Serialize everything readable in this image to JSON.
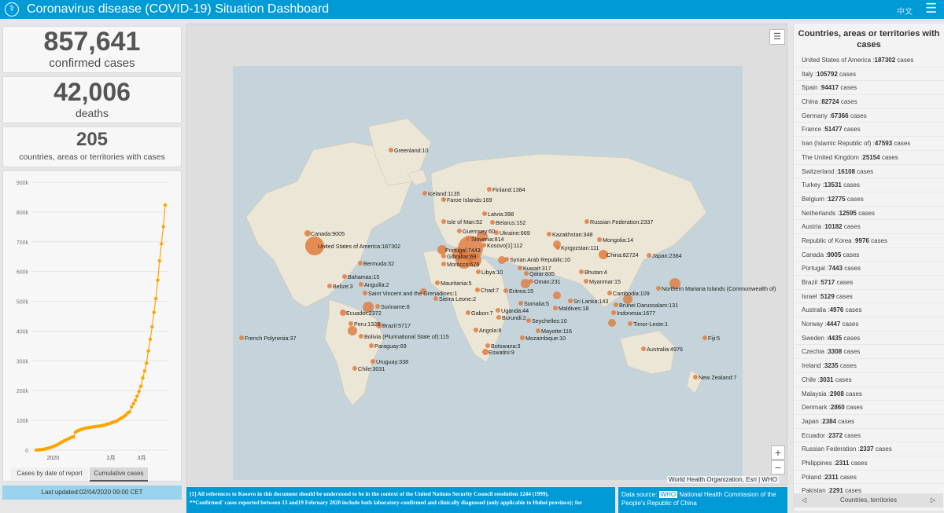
{
  "header": {
    "title": "Coronavirus disease (COVID-19) Situation Dashboard",
    "lang_label": "中文",
    "menu_icon": "hamburger-icon",
    "logo_icon": "who-logo-icon"
  },
  "stats": {
    "confirmed_value": "857,641",
    "confirmed_label": "confirmed cases",
    "deaths_value": "42,006",
    "deaths_label": "deaths",
    "countries_value": "205",
    "countries_label": "countries, areas or territories with cases"
  },
  "chart_data": {
    "type": "scatter",
    "title": "",
    "xlabel": "",
    "ylabel": "",
    "x_ticks": [
      "2020",
      "2月",
      "3月"
    ],
    "y_ticks": [
      "0",
      "100k",
      "200k",
      "300k",
      "400k",
      "500k",
      "600k",
      "700k",
      "800k",
      "900k"
    ],
    "ylim": [
      0,
      900000
    ],
    "series": [
      {
        "name": "",
        "color": "#ffa500",
        "values": [
          580,
          845,
          1317,
          2015,
          2800,
          4581,
          6057,
          7813,
          9821,
          11948,
          14551,
          17389,
          20630,
          24554,
          28276,
          31481,
          34886,
          37558,
          40554,
          43103,
          45171,
          60381,
          64543,
          67100,
          69197,
          71329,
          73332,
          75184,
          75700,
          76769,
          77794,
          78811,
          79331,
          80239,
          81109,
          82294,
          83652,
          85403,
          87137,
          89079,
          90869,
          93090,
          95324,
          97886,
          101801,
          105847,
          109821,
          113590,
          118592,
          125865,
          128343,
          145193,
          156099,
          167506,
          181546,
          197168,
          214894,
          242708,
          266073,
          292142,
          332930,
          372757,
          414179,
          462684,
          509164,
          570968,
          636350,
          693224,
          750890,
          823626
        ]
      }
    ]
  },
  "chart_tabs": {
    "daily": "Cases by date of report",
    "cumulative": "Cumulative cases"
  },
  "last_updated": "Last updated:02/04/2020 09:00 CET",
  "map": {
    "attribution": "World Health Organization, Esri | WHO",
    "zoom_in": "+",
    "zoom_out": "−",
    "labels": [
      {
        "t": "Greenland:10"
      },
      {
        "t": "Iceland:1135"
      },
      {
        "t": "Finland:1384"
      },
      {
        "t": "Faroe Islands:169"
      },
      {
        "t": "Russian Federation:2337"
      },
      {
        "t": "Canada:9005"
      },
      {
        "t": "Latvia:398"
      },
      {
        "t": "Isle of Man:52"
      },
      {
        "t": "Belarus:152"
      },
      {
        "t": "Guernsey:60"
      },
      {
        "t": "Ukraine:669"
      },
      {
        "t": "Kazakhstan:348"
      },
      {
        "t": "Mongolia:14"
      },
      {
        "t": "Slovenia:814"
      },
      {
        "t": "Kosovo[1]:112"
      },
      {
        "t": "Portugal:7443"
      },
      {
        "t": "United States of America:187302"
      },
      {
        "t": "Kyrgyzstan:111"
      },
      {
        "t": "Gibraltar:69"
      },
      {
        "t": "Syrian Arab Republic:10"
      },
      {
        "t": "China:82724"
      },
      {
        "t": "Japan:2384"
      },
      {
        "t": "Bermuda:32"
      },
      {
        "t": "Morocco:676"
      },
      {
        "t": "Libya:10"
      },
      {
        "t": "Kuwait:317"
      },
      {
        "t": "Bhutan:4"
      },
      {
        "t": "Qatar:835"
      },
      {
        "t": "Bahamas:15"
      },
      {
        "t": "Mauritania:5"
      },
      {
        "t": "Oman:231"
      },
      {
        "t": "Myanmar:15"
      },
      {
        "t": "Anguilla:2"
      },
      {
        "t": "Belize:3"
      },
      {
        "t": "Saint Vincent and the Grenadines:1"
      },
      {
        "t": "Chad:7"
      },
      {
        "t": "Eritrea:15"
      },
      {
        "t": "Northern Mariana Islands (Commonwealth of)"
      },
      {
        "t": "Cambodia:109"
      },
      {
        "t": "Sierra Leone:2"
      },
      {
        "t": "Somalia:5"
      },
      {
        "t": "Sri Lanka:143"
      },
      {
        "t": "Brunei Darussalam:131"
      },
      {
        "t": "Maldives:18"
      },
      {
        "t": "Suriname:8"
      },
      {
        "t": "Uganda:44"
      },
      {
        "t": "Indonesia:1677"
      },
      {
        "t": "Ecuador:2372"
      },
      {
        "t": "Gabon:7"
      },
      {
        "t": "Burundi:2"
      },
      {
        "t": "Seychelles:10"
      },
      {
        "t": "Timor-Leste:1"
      },
      {
        "t": "Peru:1323"
      },
      {
        "t": "Brazil:5717"
      },
      {
        "t": "Mayotte:116"
      },
      {
        "t": "Angola:8"
      },
      {
        "t": "French Polynesia:37"
      },
      {
        "t": "Bolivia (Plurinational State of):115"
      },
      {
        "t": "Mozambique:10"
      },
      {
        "t": "Fiji:5"
      },
      {
        "t": "Paraguay:69"
      },
      {
        "t": "Botswana:3"
      },
      {
        "t": "Australia:4976"
      },
      {
        "t": "Eswatini:9"
      },
      {
        "t": "Uruguay:338"
      },
      {
        "t": "Chile:3031"
      },
      {
        "t": "New Zealand:7"
      }
    ]
  },
  "footer": {
    "notes_line1": "[1] All references to Kosovo in this document should be understood to be in the context of the United Nations Security Council resolution 1244 (1999).",
    "notes_line2": "**Confirmed' cases reported between 13 and19 February 2020 include both laboratory-confirmed and clinically diagnosed (only  applicable to Hubei province); for",
    "data_source_label": "Data source:",
    "data_source_who": "WHO",
    "data_source_text": "National Health Commission of the People's Republic of China"
  },
  "list": {
    "heading": "Countries, areas or territories with cases",
    "nav_label": "Countries, territories",
    "items": [
      {
        "name": "United States of America",
        "value": "187302"
      },
      {
        "name": "Italy",
        "value": "105792"
      },
      {
        "name": "Spain",
        "value": "94417"
      },
      {
        "name": "China",
        "value": "82724"
      },
      {
        "name": "Germany",
        "value": "67366"
      },
      {
        "name": "France",
        "value": "51477"
      },
      {
        "name": "Iran (Islamic Republic of)",
        "value": "47593"
      },
      {
        "name": "The United Kingdom",
        "value": "25154"
      },
      {
        "name": "Switzerland",
        "value": "16108"
      },
      {
        "name": "Turkey",
        "value": "13531"
      },
      {
        "name": "Belgium",
        "value": "12775"
      },
      {
        "name": "Netherlands",
        "value": "12595"
      },
      {
        "name": "Austria",
        "value": "10182"
      },
      {
        "name": "Republic of Korea",
        "value": "9976"
      },
      {
        "name": "Canada",
        "value": "9005"
      },
      {
        "name": "Portugal",
        "value": "7443"
      },
      {
        "name": "Brazil",
        "value": "5717"
      },
      {
        "name": "Israel",
        "value": "5129"
      },
      {
        "name": "Australia",
        "value": "4976"
      },
      {
        "name": "Norway",
        "value": "4447"
      },
      {
        "name": "Sweden",
        "value": "4435"
      },
      {
        "name": "Czechia",
        "value": "3308"
      },
      {
        "name": "Ireland",
        "value": "3235"
      },
      {
        "name": "Chile",
        "value": "3031"
      },
      {
        "name": "Malaysia",
        "value": "2908"
      },
      {
        "name": "Denmark",
        "value": "2860"
      },
      {
        "name": "Japan",
        "value": "2384"
      },
      {
        "name": "Ecuador",
        "value": "2372"
      },
      {
        "name": "Russian Federation",
        "value": "2337"
      },
      {
        "name": "Philippines",
        "value": "2311"
      },
      {
        "name": "Poland",
        "value": "2311"
      },
      {
        "name": "Pakistan",
        "value": "2291"
      }
    ]
  }
}
